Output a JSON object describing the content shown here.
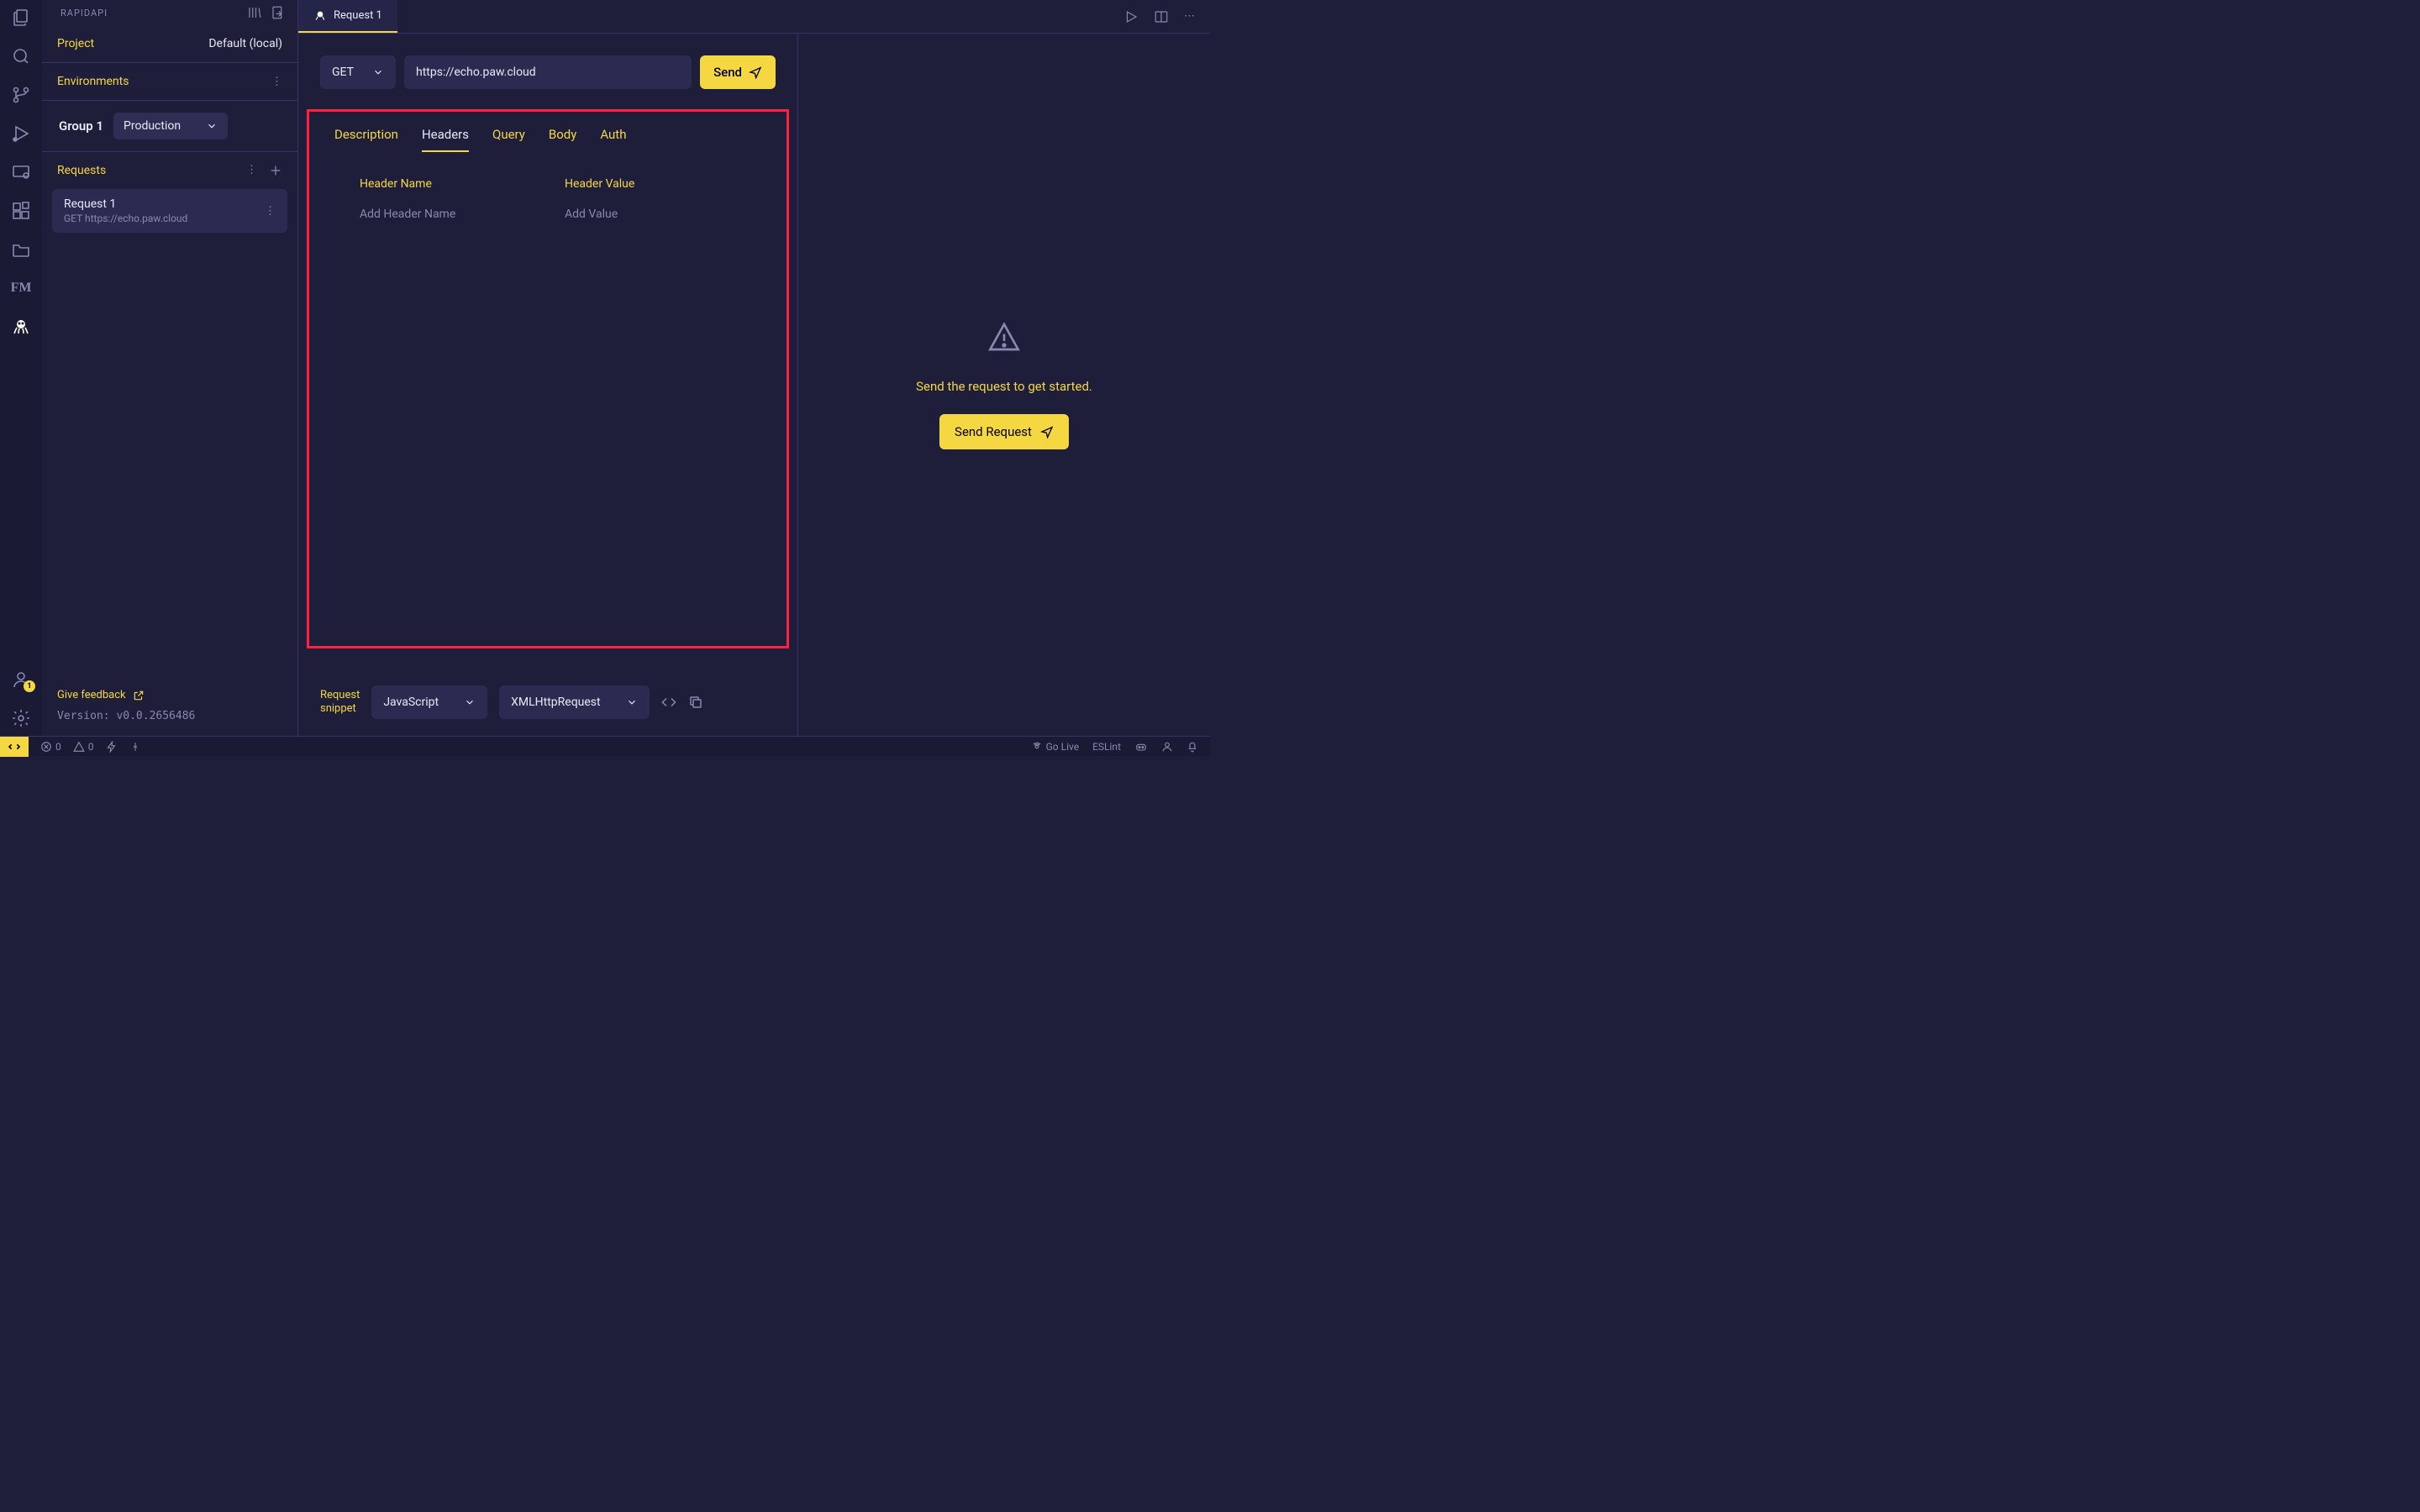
{
  "activityBar": {
    "accountBadge": "1"
  },
  "sidebar": {
    "title": "RAPIDAPI",
    "project": {
      "label": "Project",
      "value": "Default (local)"
    },
    "environments": {
      "label": "Environments"
    },
    "group": {
      "name": "Group 1",
      "selected": "Production"
    },
    "requests": {
      "label": "Requests"
    },
    "requestItem": {
      "title": "Request 1",
      "subtitle": "GET https://echo.paw.cloud"
    },
    "feedback": "Give feedback",
    "version": "Version: v0.0.2656486"
  },
  "tab": {
    "title": "Request 1"
  },
  "request": {
    "method": "GET",
    "url": "https://echo.paw.cloud",
    "sendLabel": "Send",
    "tabs": [
      "Description",
      "Headers",
      "Query",
      "Body",
      "Auth"
    ],
    "activeTab": "Headers",
    "headerCols": {
      "name": "Header Name",
      "value": "Header Value"
    },
    "headerPlaceholders": {
      "name": "Add Header Name",
      "value": "Add Value"
    },
    "snippetLabel": "Request\nsnippet",
    "snippetLang": "JavaScript",
    "snippetLib": "XMLHttpRequest"
  },
  "response": {
    "message": "Send the request to get started.",
    "buttonLabel": "Send Request"
  },
  "statusbar": {
    "errors": "0",
    "warnings": "0",
    "goLive": "Go Live",
    "eslint": "ESLint"
  }
}
